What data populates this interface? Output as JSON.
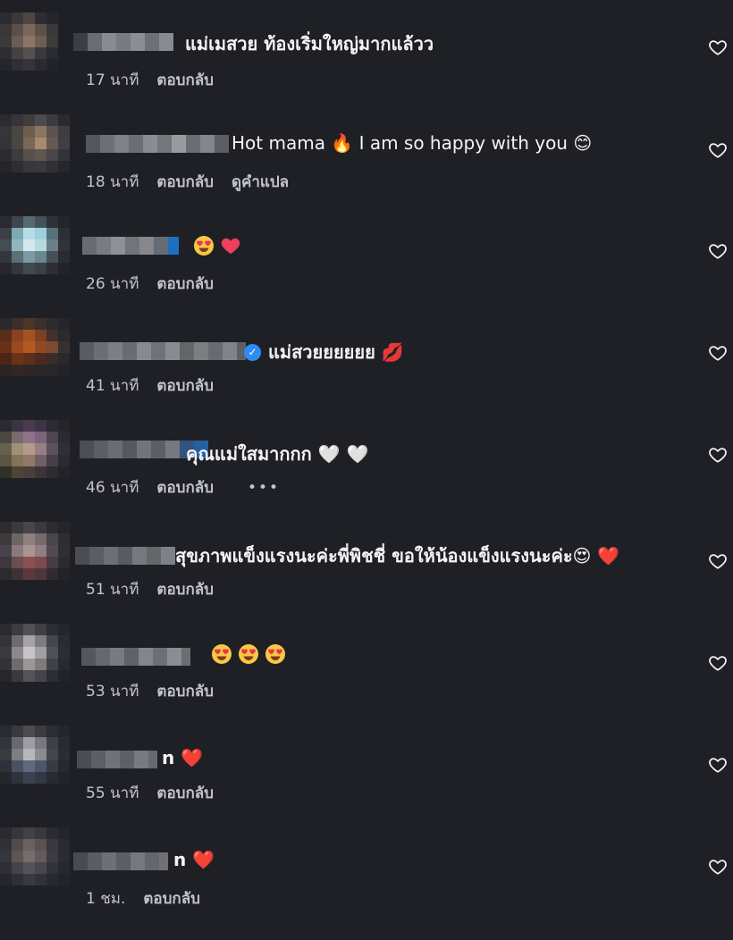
{
  "comments": [
    {
      "text": "แม่เมสวย ท้องเริ่มใหญ่มากแล้วว",
      "time": "17 นาที",
      "reply": "ตอบกลับ",
      "emojis": []
    },
    {
      "text": "Hot mama 🔥 I am so happy with you 😊",
      "time": "18 นาที",
      "reply": "ตอบกลับ",
      "translate": "ดูคำแปล",
      "emojis": []
    },
    {
      "text": "😍 ❤️",
      "time": "26 นาที",
      "reply": "ตอบกลับ",
      "emojis": [
        "heart-eyes",
        "heart"
      ]
    },
    {
      "text": "แม่สวยยยยยย 💋",
      "time": "41 นาที",
      "reply": "ตอบกลับ",
      "verified": true,
      "emojis": [
        "kiss"
      ]
    },
    {
      "text": "คุณแม่ใสมากกก 🤍 🤍",
      "time": "46 นาที",
      "reply": "ตอบกลับ",
      "more": "•••",
      "emojis": [
        "white-heart",
        "white-heart"
      ]
    },
    {
      "text": "สุขภาพแข็งแรงนะค่ะพี่พิชชี่ ขอให้น้องแข็งแรงนะค่ะ😍 ❤️",
      "time": "51 นาที",
      "reply": "ตอบกลับ",
      "emojis": [
        "heart-eyes",
        "heart"
      ]
    },
    {
      "text": "😍 😍 😍",
      "time": "53 นาที",
      "reply": "ตอบกลับ",
      "emojis": [
        "heart-eyes",
        "heart-eyes",
        "heart-eyes"
      ]
    },
    {
      "text": "n ❤️",
      "time": "55 นาที",
      "reply": "ตอบกลับ",
      "emojis": [
        "heart"
      ]
    },
    {
      "text": "n ❤️",
      "time": "1 ชม.",
      "reply": "ตอบกลับ",
      "emojis": [
        "heart"
      ]
    }
  ],
  "colors": {
    "background": "#1f2026",
    "text": "#f4f4f4",
    "meta": "#c3c4ca",
    "verified": "#2d8cf0",
    "heart": "#ef3e5f"
  }
}
